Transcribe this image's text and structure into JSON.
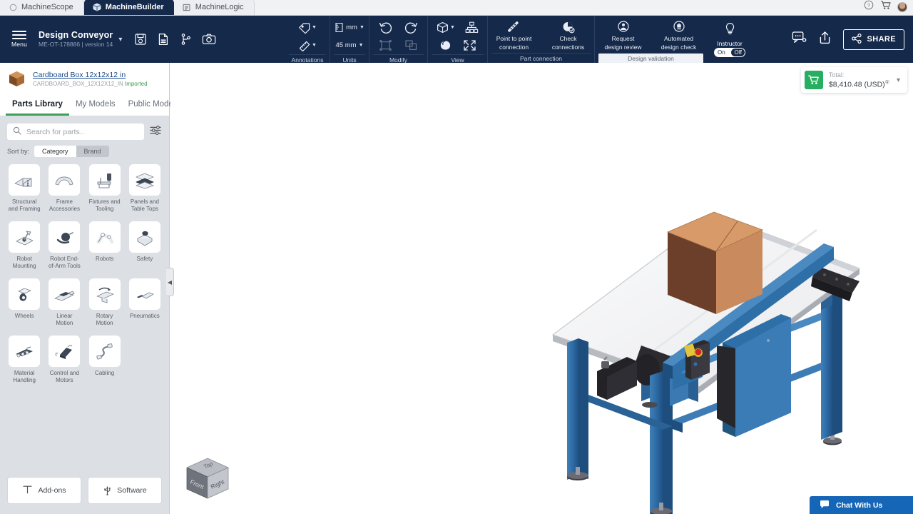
{
  "app_tabs": [
    {
      "label": "MachineScope",
      "icon": "circle-icon",
      "active": false
    },
    {
      "label": "MachineBuilder",
      "icon": "cube-icon",
      "active": true
    },
    {
      "label": "MachineLogic",
      "icon": "list-icon",
      "active": false
    }
  ],
  "window_controls": {
    "help_icon": "help-circle-icon",
    "cart_icon": "cart-icon",
    "avatar": "user-avatar"
  },
  "header": {
    "menu_label": "Menu",
    "doc_title": "Design Conveyor",
    "doc_subtitle": "ME-OT-178886 | version 14",
    "dropdown_caret": "chevron-down-icon",
    "file_icons": [
      {
        "name": "save-icon",
        "label": "Save"
      },
      {
        "name": "bom-icon",
        "label": "BOM"
      },
      {
        "name": "branch-icon",
        "label": "Branch"
      },
      {
        "name": "camera-icon",
        "label": "Screenshot"
      }
    ],
    "share_label": "SHARE",
    "share_icon": "share-nodes-icon",
    "comment_icon": "comment-icon",
    "export_icon": "upload-icon"
  },
  "ribbon": {
    "groups": [
      {
        "label": "Annotations",
        "highlight": false,
        "tools": [
          {
            "name": "annotation-tag-tool",
            "icon": "tag-icon",
            "caret": true,
            "disabled": false
          },
          {
            "name": "measure-tool",
            "icon": "ruler-icon",
            "caret": true,
            "disabled": false
          }
        ]
      },
      {
        "label": "Units",
        "highlight": false,
        "tools": [
          {
            "name": "unit-system-select",
            "icon": "ruler-unit-icon",
            "caption": "mm",
            "caret": true,
            "disabled": false
          },
          {
            "name": "grid-size-select",
            "icon": "",
            "caption": "45 mm",
            "caret": true,
            "disabled": false
          }
        ]
      },
      {
        "label": "Modify",
        "highlight": false,
        "tools": [
          {
            "name": "undo-button",
            "icon": "undo-icon",
            "disabled": false
          },
          {
            "name": "redo-button",
            "icon": "redo-icon",
            "disabled": false
          },
          {
            "name": "group-button",
            "icon": "group-icon",
            "disabled": true
          },
          {
            "name": "ungroup-button",
            "icon": "ungroup-icon",
            "disabled": true
          }
        ]
      },
      {
        "label": "View",
        "highlight": false,
        "tools": [
          {
            "name": "view-orientation-button",
            "icon": "cube-icon",
            "caret": true,
            "disabled": false
          },
          {
            "name": "assembly-tree-button",
            "icon": "tree-icon",
            "disabled": false
          },
          {
            "name": "shading-button",
            "icon": "shading-icon",
            "disabled": false
          },
          {
            "name": "zoom-fit-button",
            "icon": "zoom-fit-icon",
            "disabled": false
          }
        ]
      }
    ],
    "big_groups": [
      {
        "label": "Part connection",
        "highlight": false,
        "buttons": [
          {
            "name": "point-to-point-connection-button",
            "line1": "Point to point",
            "line2": "connection",
            "icon": "chain-icon"
          },
          {
            "name": "check-connections-button",
            "line1": "Check",
            "line2": "connections",
            "icon": "pie-check-icon"
          }
        ]
      },
      {
        "label": "Design validation",
        "highlight": true,
        "buttons": [
          {
            "name": "request-design-review-button",
            "line1": "Request",
            "line2": "design review",
            "icon": "review-person-icon"
          },
          {
            "name": "automated-design-check-button",
            "line1": "Automated",
            "line2": "design check",
            "icon": "robot-check-icon"
          }
        ]
      }
    ],
    "instructor": {
      "label": "Instructor",
      "icon": "lightbulb-icon",
      "on_label": "On",
      "off_label": "Off",
      "selected": "Off"
    }
  },
  "sidebar": {
    "part_info": {
      "title": "Cardboard Box 12x12x12 in",
      "code": "CARDBOARD_BOX_12X12X12_IN",
      "status": "Imported",
      "thumb_icon": "box-icon"
    },
    "tabs": [
      {
        "label": "Parts Library",
        "active": true
      },
      {
        "label": "My Models",
        "active": false
      },
      {
        "label": "Public Models",
        "active": false
      }
    ],
    "search": {
      "placeholder": "Search for parts..",
      "value": "",
      "icon": "search-icon",
      "filter_icon": "filter-sliders-icon"
    },
    "sort": {
      "label": "Sort by:",
      "options": [
        {
          "label": "Category",
          "active": true
        },
        {
          "label": "Brand",
          "active": false
        }
      ]
    },
    "categories": [
      {
        "name": "structural-and-framing",
        "line1": "Structural",
        "line2": "and Framing",
        "icon": "bracket-icon"
      },
      {
        "name": "frame-accessories",
        "line1": "Frame",
        "line2": "Accessories",
        "icon": "frame-accessory-icon"
      },
      {
        "name": "fixtures-and-tooling",
        "line1": "Fixtures and",
        "line2": "Tooling",
        "icon": "fixture-icon"
      },
      {
        "name": "panels-and-table-tops",
        "line1": "Panels and",
        "line2": "Table Tops",
        "icon": "panels-icon"
      },
      {
        "name": "robot-mounting",
        "line1": "Robot",
        "line2": "Mounting",
        "icon": "robot-mount-icon"
      },
      {
        "name": "robot-end-of-arm-tools",
        "line1": "Robot End-",
        "line2": "of-Arm Tools",
        "icon": "gripper-icon"
      },
      {
        "name": "robots",
        "line1": "Robots",
        "line2": "",
        "icon": "robot-arm-icon"
      },
      {
        "name": "safety",
        "line1": "Safety",
        "line2": "",
        "icon": "safety-icon"
      },
      {
        "name": "wheels",
        "line1": "Wheels",
        "line2": "",
        "icon": "caster-wheel-icon"
      },
      {
        "name": "linear-motion",
        "line1": "Linear",
        "line2": "Motion",
        "icon": "linear-rail-icon"
      },
      {
        "name": "rotary-motion",
        "line1": "Rotary",
        "line2": "Motion",
        "icon": "rotary-icon"
      },
      {
        "name": "pneumatics",
        "line1": "Pneumatics",
        "line2": "",
        "icon": "cylinder-icon"
      },
      {
        "name": "material-handling",
        "line1": "Material",
        "line2": "Handling",
        "icon": "conveyor-icon"
      },
      {
        "name": "control-and-motors",
        "line1": "Control and",
        "line2": "Motors",
        "icon": "motor-icon"
      },
      {
        "name": "cabling",
        "line1": "Cabling",
        "line2": "",
        "icon": "cable-icon"
      }
    ],
    "footer_buttons": [
      {
        "name": "add-ons-button",
        "label": "Add-ons",
        "icon": "addon-icon"
      },
      {
        "name": "software-button",
        "label": "Software",
        "icon": "usb-icon"
      }
    ],
    "collapse_icon": "chevron-left-icon"
  },
  "canvas": {
    "cart": {
      "total_label": "Total:",
      "amount": "$8,410.48 (USD)",
      "info_marker": "①",
      "cart_icon": "cart-icon",
      "caret": "chevron-down-icon",
      "accent_color": "#27ae60"
    },
    "viewcube": {
      "faces": [
        "Top",
        "Front",
        "Right"
      ]
    },
    "chat": {
      "label": "Chat With Us",
      "icon": "chat-bubble-icon",
      "color": "#1666b8"
    },
    "model": {
      "name": "conveyor-assembly",
      "parts": [
        "cardboard-box",
        "belt-conveyor",
        "frame-legs",
        "motor",
        "e-stop",
        "control-box"
      ],
      "colors": {
        "frame": "#2f6fa8",
        "frame_dark": "#1d4e7d",
        "belt": "#f2f3f4",
        "box_front": "#c98b5e",
        "box_side": "#6b3f2a",
        "box_top": "#d79a68",
        "black_part": "#2b2b30"
      }
    }
  }
}
